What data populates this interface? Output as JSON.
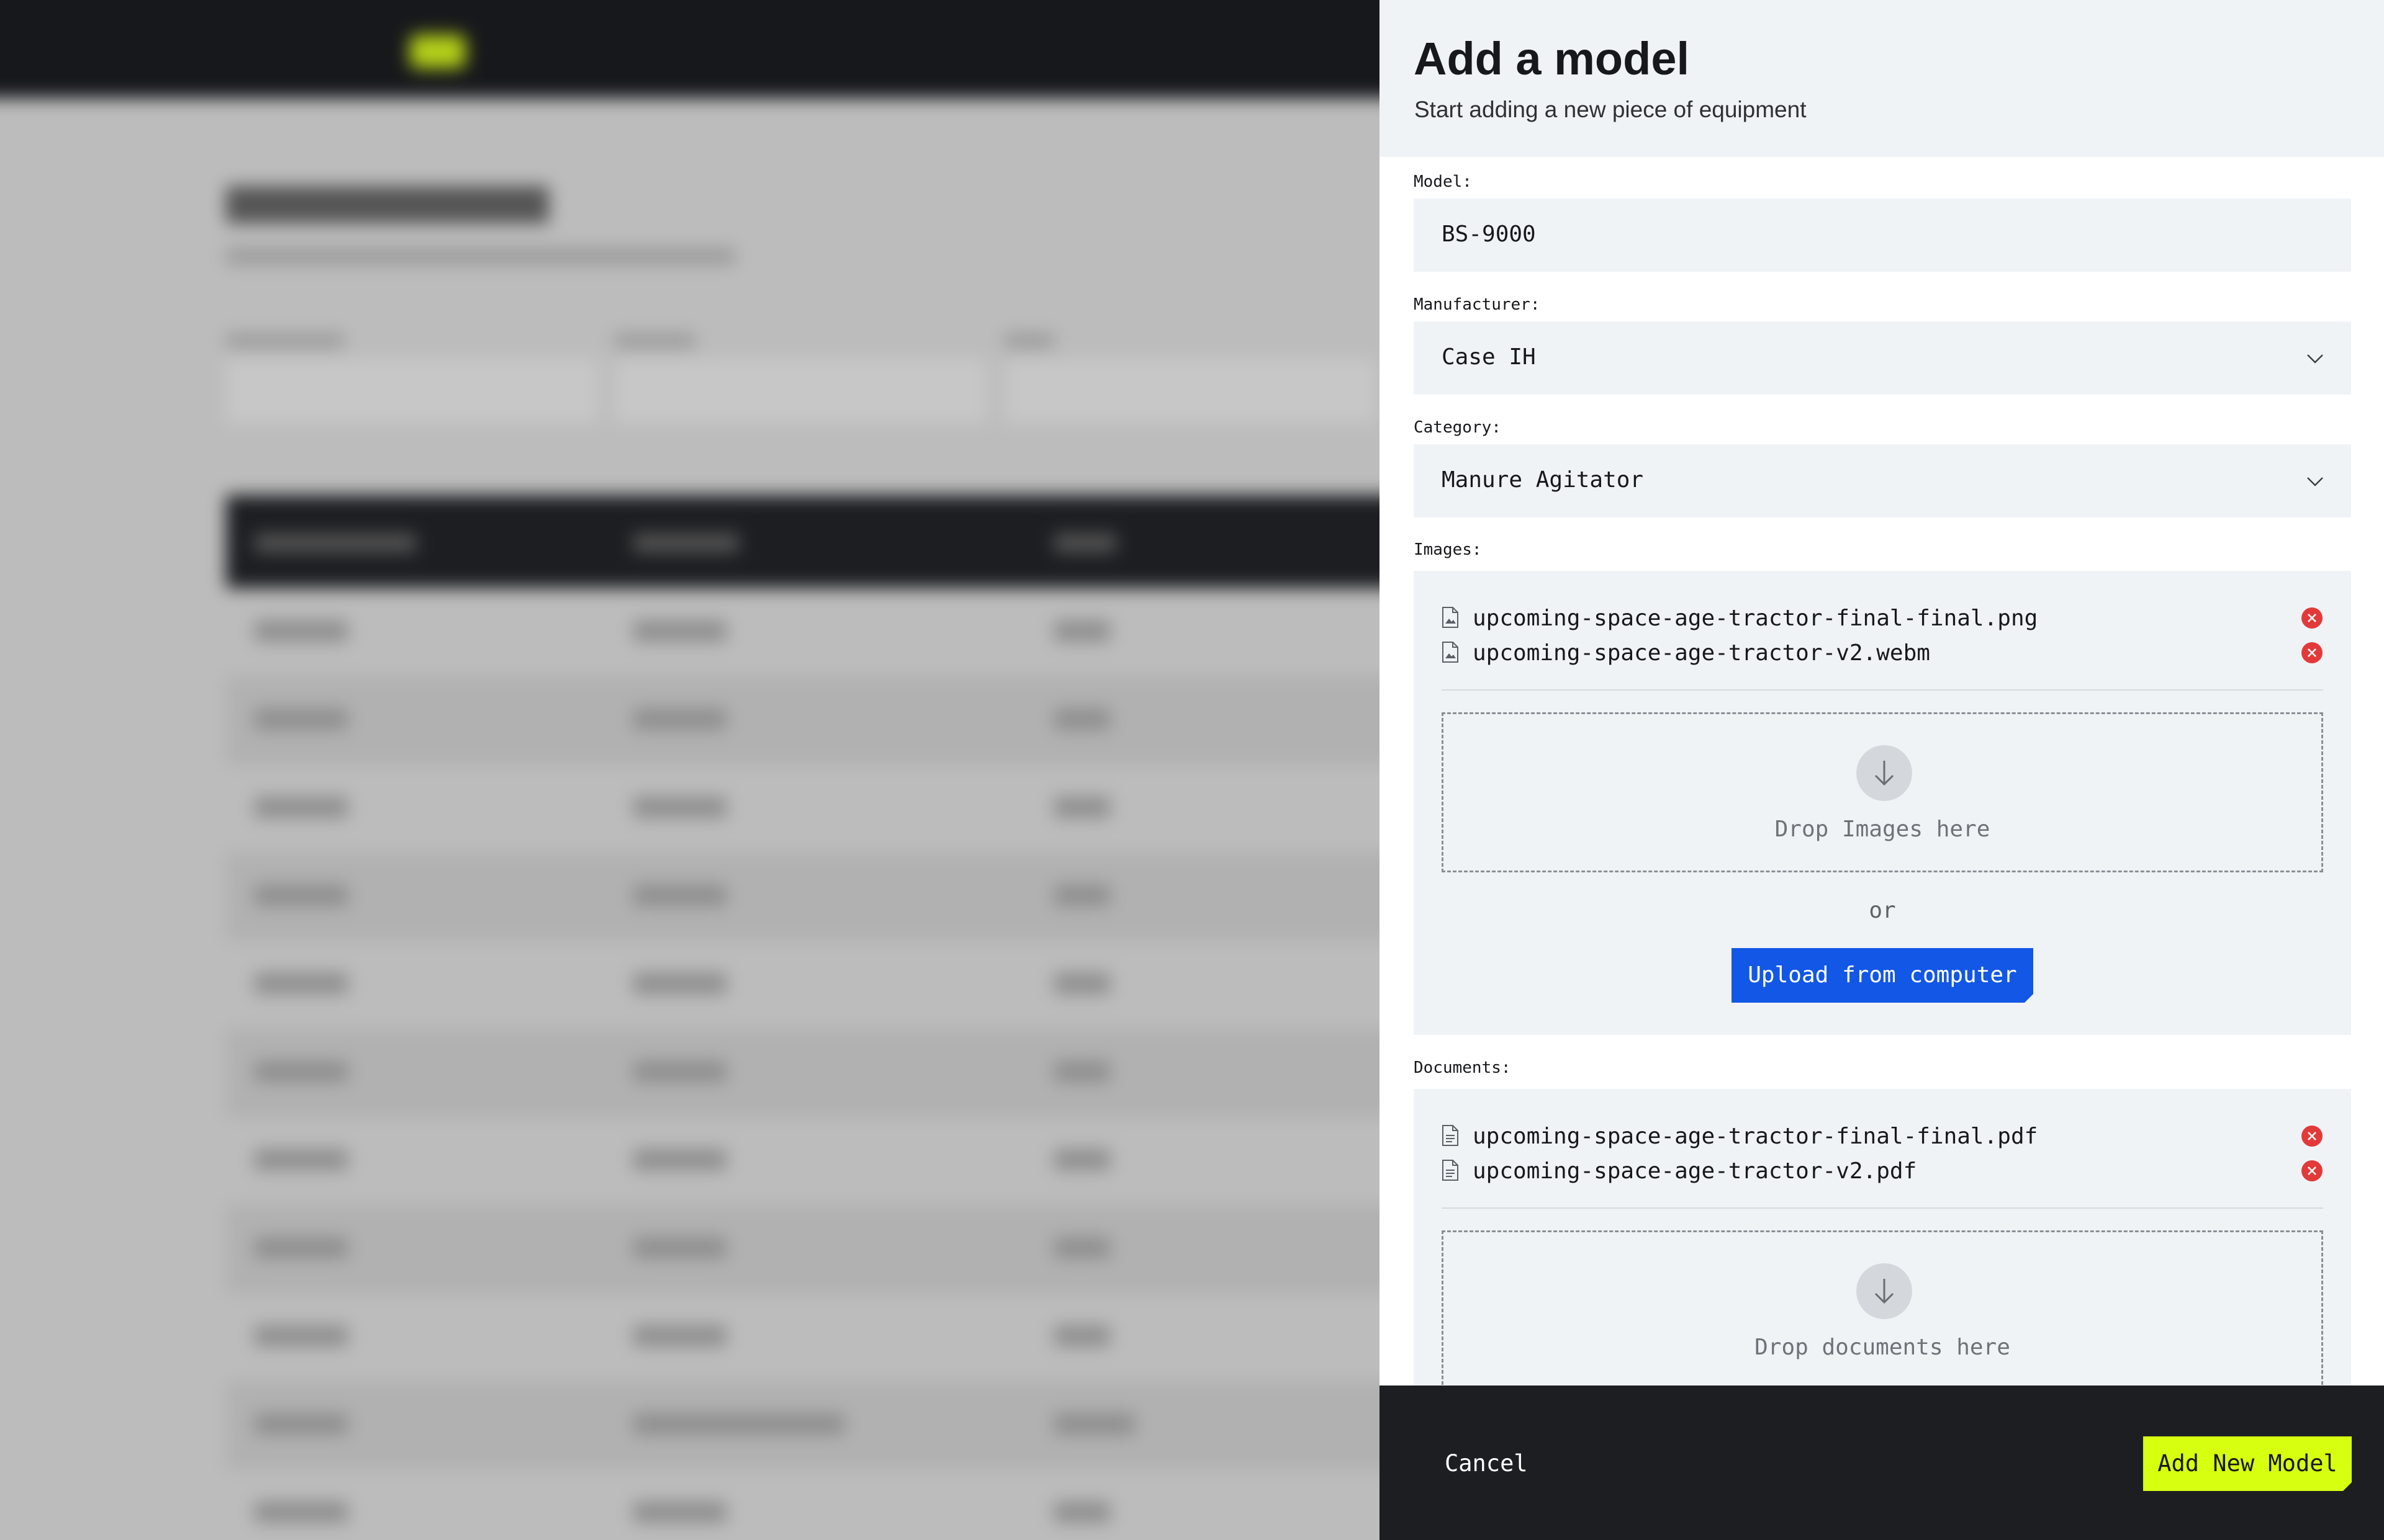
{
  "drawer": {
    "title": "Add a model",
    "subtitle": "Start adding a new piece of equipment"
  },
  "form": {
    "model": {
      "label": "Model:",
      "value": "BS-9000"
    },
    "manufacturer": {
      "label": "Manufacturer:",
      "value": "Case IH",
      "icon": "chevron-down-icon"
    },
    "category": {
      "label": "Category:",
      "value": "Manure Agitator",
      "icon": "chevron-down-icon"
    },
    "images": {
      "label": "Images:",
      "files": [
        "upcoming-space-age-tractor-final-final.png",
        "upcoming-space-age-tractor-v2.webm"
      ],
      "drop_text": "Drop Images here",
      "or_text": "or",
      "upload_button": "Upload from computer"
    },
    "documents": {
      "label": "Documents:",
      "files": [
        "upcoming-space-age-tractor-final-final.pdf",
        "upcoming-space-age-tractor-v2.pdf"
      ],
      "drop_text": "Drop documents here"
    }
  },
  "footer": {
    "cancel_label": "Cancel",
    "submit_label": "Add New Model"
  },
  "colors": {
    "primary_blue": "#1257e6",
    "accent_lime": "#d7ff10",
    "dark": "#1d1e21",
    "field_bg": "#f0f3f6",
    "remove_red": "#e23a3a"
  }
}
